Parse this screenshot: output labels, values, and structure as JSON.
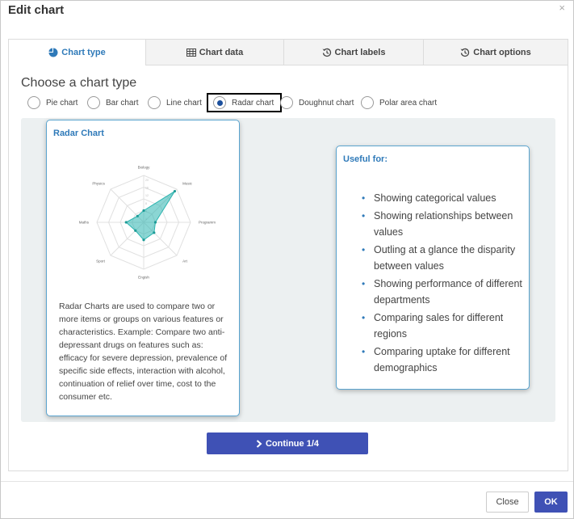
{
  "dialog": {
    "title": "Edit chart",
    "close_glyph": "×"
  },
  "tabs": [
    {
      "label": "Chart type",
      "icon": "pie-chart-icon",
      "active": true
    },
    {
      "label": "Chart data",
      "icon": "table-icon",
      "active": false
    },
    {
      "label": "Chart labels",
      "icon": "history-icon",
      "active": false
    },
    {
      "label": "Chart options",
      "icon": "history-icon",
      "active": false
    }
  ],
  "choose": {
    "title": "Choose a chart type",
    "options": [
      {
        "label": "Pie chart",
        "selected": false
      },
      {
        "label": "Bar chart",
        "selected": false
      },
      {
        "label": "Line chart",
        "selected": false
      },
      {
        "label": "Radar chart",
        "selected": true
      },
      {
        "label": "Doughnut chart",
        "selected": false
      },
      {
        "label": "Polar area chart",
        "selected": false
      }
    ]
  },
  "preview": {
    "title": "Radar Chart",
    "description": "Radar Charts are used to compare two or more items or groups on various features or characteristics. Example: Compare two anti-depressant drugs on features such as: efficacy for severe depression, prevalence of specific side effects, interaction with alcohol, continuation of relief over time, cost to the consumer etc."
  },
  "useful": {
    "title": "Useful for:",
    "items": [
      "Showing categorical values",
      "Showing relationships between values",
      "Outling at a glance the disparity between values",
      "Showing performance of different departments",
      "Comparing sales for different regions",
      "Comparing uptake for different demographics"
    ]
  },
  "buttons": {
    "continue": "Continue 1/4",
    "close": "Close",
    "ok": "OK"
  },
  "colors": {
    "accent": "#2f7ab9",
    "primary_button": "#3f51b5",
    "radar_fill": "#2bb5b0"
  },
  "chart_data": {
    "type": "radar",
    "categories": [
      "Biology",
      "Music",
      "Programm",
      "Art",
      "Engish",
      "Sport",
      "Maths",
      "Physics"
    ],
    "values": [
      4,
      15,
      4,
      5,
      6,
      4,
      6,
      3
    ],
    "rlim": [
      0,
      16
    ],
    "ticks": [
      "1",
      "4",
      "8",
      "12",
      "16",
      "20"
    ]
  }
}
